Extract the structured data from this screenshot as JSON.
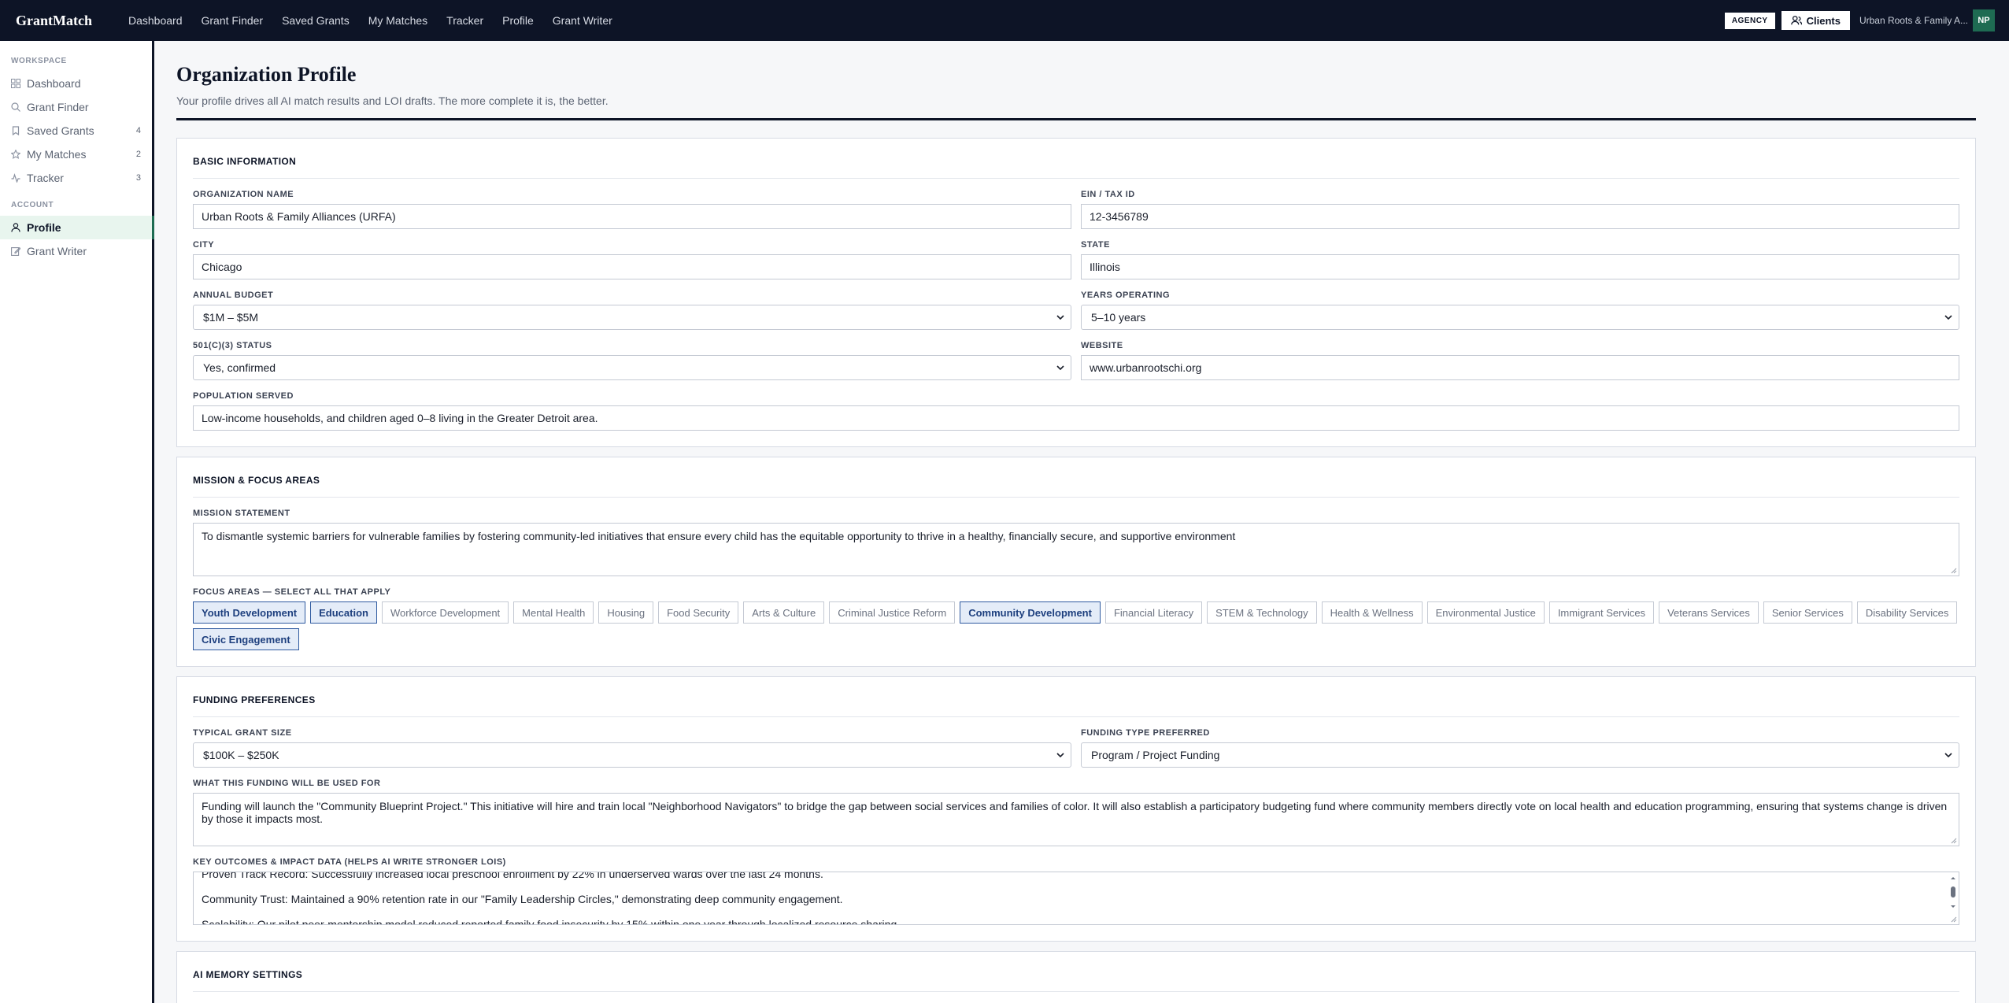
{
  "app": {
    "logo": "GrantMatch",
    "nav": [
      "Dashboard",
      "Grant Finder",
      "Saved Grants",
      "My Matches",
      "Tracker",
      "Profile",
      "Grant Writer"
    ],
    "agency_badge": "AGENCY",
    "clients_label": "Clients",
    "org_short": "Urban Roots & Family A...",
    "avatar_initials": "NP"
  },
  "sidebar": {
    "workspace_heading": "WORKSPACE",
    "workspace_items": [
      {
        "label": "Dashboard",
        "icon": "grid-icon",
        "count": ""
      },
      {
        "label": "Grant Finder",
        "icon": "search-icon",
        "count": ""
      },
      {
        "label": "Saved Grants",
        "icon": "bookmark-icon",
        "count": "4"
      },
      {
        "label": "My Matches",
        "icon": "star-icon",
        "count": "2"
      },
      {
        "label": "Tracker",
        "icon": "activity-icon",
        "count": "3"
      }
    ],
    "account_heading": "ACCOUNT",
    "account_items": [
      {
        "label": "Profile",
        "icon": "user-icon",
        "active": true
      },
      {
        "label": "Grant Writer",
        "icon": "edit-icon",
        "active": false
      }
    ]
  },
  "page": {
    "title": "Organization Profile",
    "subtitle": "Your profile drives all AI match results and LOI drafts. The more complete it is, the better."
  },
  "basic": {
    "title": "BASIC INFORMATION",
    "org_name_label": "ORGANIZATION NAME",
    "org_name": "Urban Roots & Family Alliances (URFA)",
    "ein_label": "EIN / TAX ID",
    "ein": "12-3456789",
    "city_label": "CITY",
    "city": "Chicago",
    "state_label": "STATE",
    "state": "Illinois",
    "budget_label": "ANNUAL BUDGET",
    "budget": "$1M – $5M",
    "years_label": "YEARS OPERATING",
    "years": "5–10 years",
    "status_label": "501(C)(3) STATUS",
    "status": "Yes, confirmed",
    "website_label": "WEBSITE",
    "website": "www.urbanrootschi.org",
    "population_label": "POPULATION SERVED",
    "population": "Low-income households, and children aged 0–8 living in the Greater Detroit area."
  },
  "mission": {
    "title": "MISSION & FOCUS AREAS",
    "statement_label": "MISSION STATEMENT",
    "statement": "To dismantle systemic barriers for vulnerable families by fostering community-led initiatives that ensure every child has the equitable opportunity to thrive in a healthy, financially secure, and supportive environment",
    "focus_label": "FOCUS AREAS — SELECT ALL THAT APPLY",
    "focus_areas": [
      {
        "label": "Youth Development",
        "selected": true
      },
      {
        "label": "Education",
        "selected": true
      },
      {
        "label": "Workforce Development",
        "selected": false
      },
      {
        "label": "Mental Health",
        "selected": false
      },
      {
        "label": "Housing",
        "selected": false
      },
      {
        "label": "Food Security",
        "selected": false
      },
      {
        "label": "Arts & Culture",
        "selected": false
      },
      {
        "label": "Criminal Justice Reform",
        "selected": false
      },
      {
        "label": "Community Development",
        "selected": true
      },
      {
        "label": "Financial Literacy",
        "selected": false
      },
      {
        "label": "STEM & Technology",
        "selected": false
      },
      {
        "label": "Health & Wellness",
        "selected": false
      },
      {
        "label": "Environmental Justice",
        "selected": false
      },
      {
        "label": "Immigrant Services",
        "selected": false
      },
      {
        "label": "Veterans Services",
        "selected": false
      },
      {
        "label": "Senior Services",
        "selected": false
      },
      {
        "label": "Disability Services",
        "selected": false
      },
      {
        "label": "Civic Engagement",
        "selected": true
      }
    ]
  },
  "funding": {
    "title": "FUNDING PREFERENCES",
    "size_label": "TYPICAL GRANT SIZE",
    "size": "$100K – $250K",
    "type_label": "FUNDING TYPE PREFERRED",
    "type": "Program / Project Funding",
    "use_label": "WHAT THIS FUNDING WILL BE USED FOR",
    "use": "Funding will launch the \"Community Blueprint Project.\" This initiative will hire and train local \"Neighborhood Navigators\" to bridge the gap between social services and families of color. It will also establish a participatory budgeting fund where community members directly vote on local health and education programming, ensuring that systems change is driven by those it impacts most.",
    "outcomes_label": "KEY OUTCOMES & IMPACT DATA (HELPS AI WRITE STRONGER LOIS)",
    "outcomes": [
      "Proven Track Record: Successfully increased local preschool enrollment by 22% in underserved wards over the last 24 months.",
      "Community Trust: Maintained a 90% retention rate in our \"Family Leadership Circles,\" demonstrating deep community engagement.",
      "Scalability: Our pilot peer-mentorship model reduced reported family food insecurity by 15% within one year through localized resource sharing."
    ]
  },
  "memory": {
    "title": "AI MEMORY SETTINGS"
  }
}
